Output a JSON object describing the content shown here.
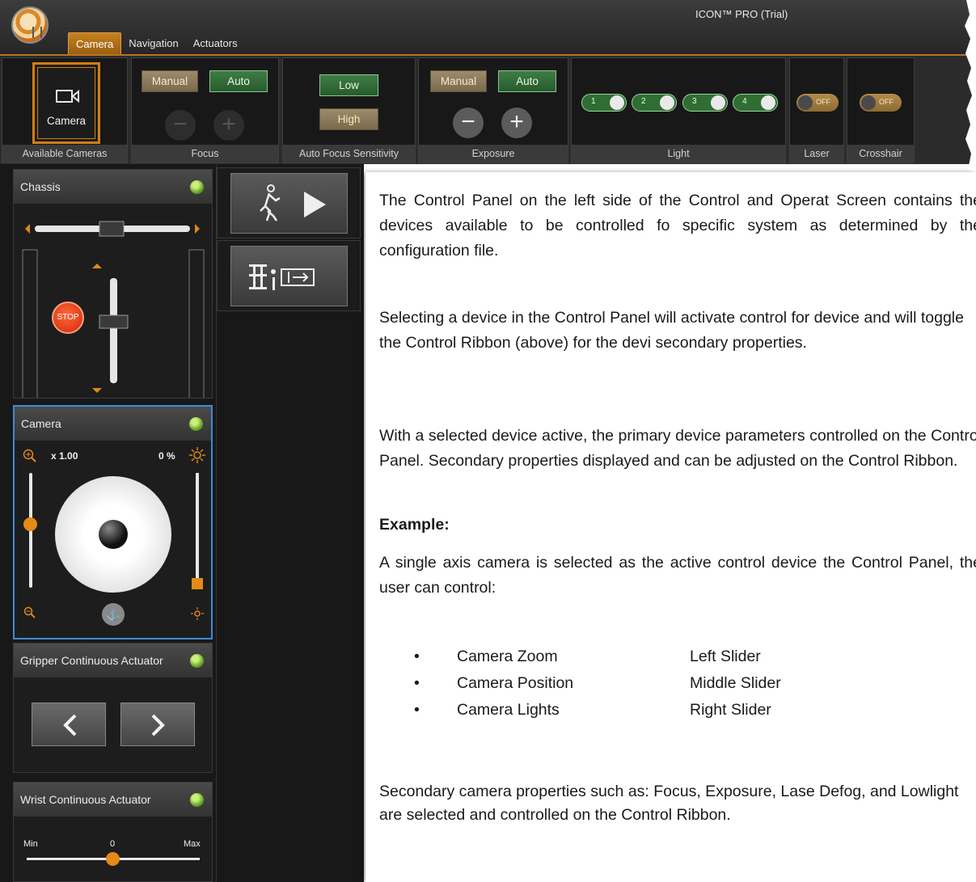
{
  "window": {
    "title": "ICON™ PRO (Trial)"
  },
  "tabs": [
    "Camera",
    "Navigation",
    "Actuators"
  ],
  "ribbon": {
    "available_cameras": {
      "label": "Available Cameras",
      "camera_label": "Camera"
    },
    "focus": {
      "label": "Focus",
      "manual": "Manual",
      "auto": "Auto",
      "minus": "−",
      "plus": "+"
    },
    "afs": {
      "label": "Auto Focus Sensitivity",
      "low": "Low",
      "high": "High"
    },
    "exposure": {
      "label": "Exposure",
      "manual": "Manual",
      "auto": "Auto",
      "minus": "−",
      "plus": "+"
    },
    "light": {
      "label": "Light",
      "toggles": [
        "1",
        "2",
        "3",
        "4"
      ]
    },
    "laser": {
      "label": "Laser",
      "state": "OFF"
    },
    "crosshair": {
      "label": "Crosshair",
      "state": "OFF"
    }
  },
  "panel": {
    "chassis": {
      "title": "Chassis",
      "stop": "STOP"
    },
    "camera": {
      "title": "Camera",
      "zoom": "x 1.00",
      "light_pct": "0 %"
    },
    "gripper": {
      "title": "Gripper Continuous Actuator"
    },
    "wrist": {
      "title": "Wrist Continuous Actuator",
      "min": "Min",
      "value": "0",
      "max": "Max"
    }
  },
  "doc": {
    "p1": "The Control Panel on the left side of the Control and Operat Screen contains the devices available to be controlled fo specific system as determined by the configuration file.",
    "p2": "Selecting a device in the Control Panel will activate control for device and will toggle the Control Ribbon (above) for the devi secondary properties.",
    "p3": "With a selected device active, the primary device parameters controlled on the Control Panel. Secondary properties displayed and can be adjusted on the Control Ribbon.",
    "example_heading": "Example:",
    "p4": "A single axis camera is selected as the active control device the Control Panel, the user can control:",
    "list": [
      {
        "item": "Camera Zoom",
        "control": "Left Slider"
      },
      {
        "item": "Camera Position",
        "control": "Middle Slider"
      },
      {
        "item": "Camera Lights",
        "control": "Right Slider"
      }
    ],
    "p5": "Secondary camera properties such as: Focus, Exposure, Lase Defog, and Lowlight are selected and controlled on the Control Ribbon."
  },
  "colors": {
    "accent": "#c7811f",
    "active_green": "#3f7e46",
    "panel_bg": "#181818",
    "selected_border": "#3f8ad6"
  }
}
